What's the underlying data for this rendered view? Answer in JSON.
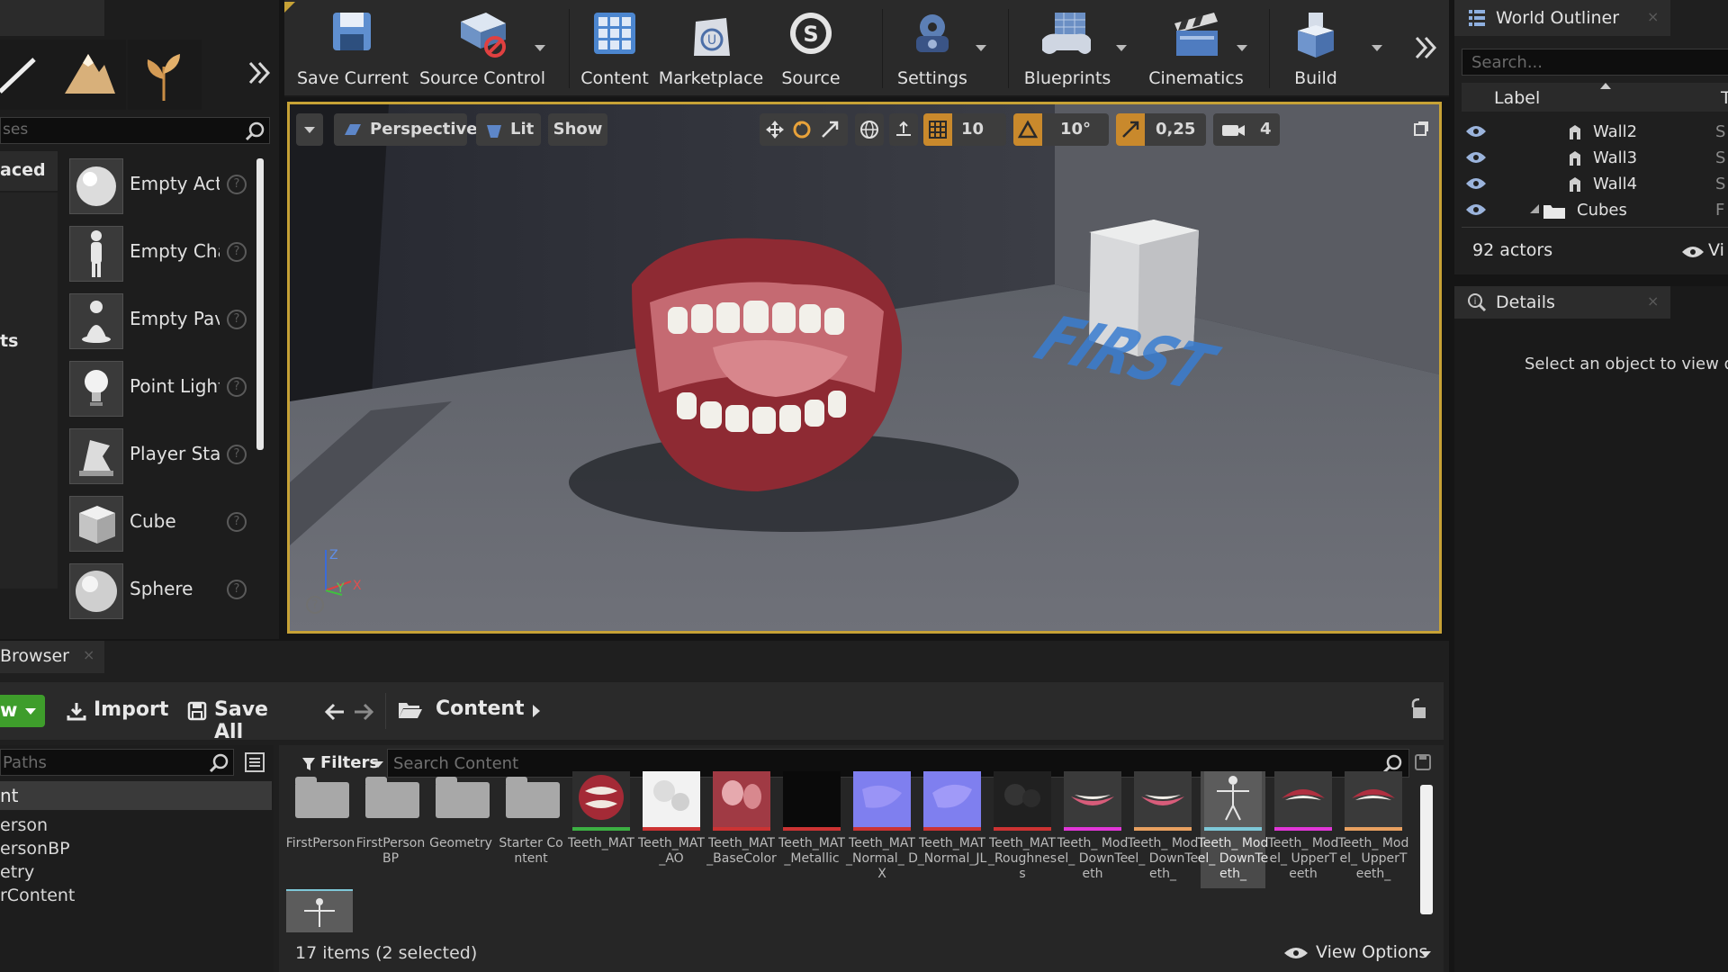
{
  "toolbar": {
    "save_current": "Save Current",
    "source_control": "Source Control",
    "content": "Content",
    "marketplace": "Marketplace",
    "source": "Source",
    "settings": "Settings",
    "blueprints": "Blueprints",
    "cinematics": "Cinematics",
    "build": "Build"
  },
  "modes": {
    "search_placeholder": "ses",
    "category_recent": "aced",
    "category_lights": "ts",
    "items": [
      {
        "label": "Empty Act"
      },
      {
        "label": "Empty Cha"
      },
      {
        "label": "Empty Pav"
      },
      {
        "label": "Point Light"
      },
      {
        "label": "Player Sta"
      },
      {
        "label": "Cube"
      },
      {
        "label": "Sphere"
      }
    ]
  },
  "viewport": {
    "view_mode": "Perspective",
    "lighting": "Lit",
    "show": "Show",
    "grid_snap": "10",
    "rotation_snap": "10°",
    "scale_snap": "0,25",
    "camera_speed": "4",
    "floor_text": "FIRST",
    "axis_z": "Z",
    "axis_y": "Y",
    "axis_x": "X"
  },
  "outliner": {
    "title": "World Outliner",
    "search_placeholder": "Search...",
    "col_label": "Label",
    "col_type": "T",
    "rows": [
      {
        "label": "Wall2",
        "type": "S"
      },
      {
        "label": "Wall3",
        "type": "S"
      },
      {
        "label": "Wall4",
        "type": "S"
      },
      {
        "label": "Cubes",
        "type": "F"
      }
    ],
    "actor_count": "92 actors",
    "view_options": "Vi"
  },
  "details": {
    "title": "Details",
    "empty_message": "Select an object to view de"
  },
  "content_browser": {
    "tab_title": "Browser",
    "add_new": "w",
    "import": "Import",
    "save_all": "Save All",
    "path_root": "Content",
    "paths_placeholder": "Paths",
    "filters": "Filters",
    "search_placeholder": "Search Content",
    "tree": [
      "nt",
      "erson",
      "ersonBP",
      "etry",
      "rContent"
    ],
    "assets": [
      {
        "label": "FirstPerson",
        "kind": "folder"
      },
      {
        "label": "FirstPerson BP",
        "kind": "folder"
      },
      {
        "label": "Geometry",
        "kind": "folder"
      },
      {
        "label": "Starter Content",
        "kind": "folder"
      },
      {
        "label": "Teeth_MAT",
        "kind": "material"
      },
      {
        "label": "Teeth_MAT _AO",
        "kind": "texture"
      },
      {
        "label": "Teeth_MAT _BaseColor",
        "kind": "texture"
      },
      {
        "label": "Teeth_MAT _Metallic",
        "kind": "texture"
      },
      {
        "label": "Teeth_MAT _Normal_ DX",
        "kind": "texture"
      },
      {
        "label": "Teeth_MAT _Normal_JL",
        "kind": "texture"
      },
      {
        "label": "Teeth_MAT _Roughness",
        "kind": "texture"
      },
      {
        "label": "Teeth_ Model_ DownTeeth",
        "kind": "mesh"
      },
      {
        "label": "Teeth_ Model_ DownTeeth_",
        "kind": "mesh"
      },
      {
        "label": "Teeth_ Model_ DownTeeth_",
        "kind": "skeleton"
      },
      {
        "label": "Teeth_ Model_ UpperTeeth",
        "kind": "mesh"
      },
      {
        "label": "Teeth_ Model_ UpperTeeth_",
        "kind": "mesh"
      }
    ],
    "status": "17 items (2 selected)",
    "view_options": "View Options"
  },
  "colors": {
    "viewport_border": "#c7a236",
    "panel_bg": "#1f1f1f",
    "accent_green": "#3e9d2b"
  }
}
